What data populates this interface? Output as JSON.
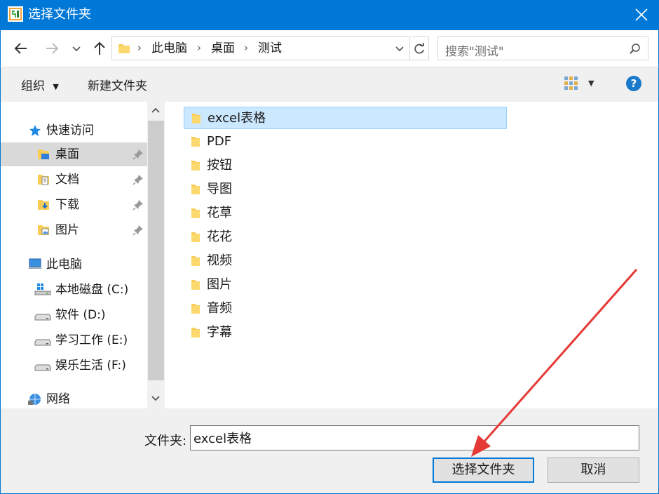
{
  "window": {
    "title": "选择文件夹",
    "accent": "#0078d7"
  },
  "address_bar": {
    "path": [
      "此电脑",
      "桌面",
      "测试"
    ]
  },
  "search": {
    "placeholder": "搜索\"测试\""
  },
  "toolbar": {
    "organize_label": "组织",
    "new_folder_label": "新建文件夹"
  },
  "nav_pane": {
    "quick_access": "快速访问",
    "quick_items": [
      {
        "label": "桌面",
        "icon": "desktop-folder-icon"
      },
      {
        "label": "文档",
        "icon": "documents-folder-icon"
      },
      {
        "label": "下载",
        "icon": "downloads-folder-icon"
      },
      {
        "label": "图片",
        "icon": "pictures-folder-icon"
      }
    ],
    "this_pc": "此电脑",
    "drives": [
      {
        "label": "本地磁盘 (C:)",
        "icon": "windows-drive-icon"
      },
      {
        "label": "软件 (D:)",
        "icon": "drive-icon"
      },
      {
        "label": "学习工作 (E:)",
        "icon": "drive-icon"
      },
      {
        "label": "娱乐生活 (F:)",
        "icon": "drive-icon"
      }
    ],
    "network": "网络"
  },
  "files": [
    {
      "name": "excel表格",
      "selected": true
    },
    {
      "name": "PDF"
    },
    {
      "name": "按钮"
    },
    {
      "name": "导图"
    },
    {
      "name": "花草"
    },
    {
      "name": "花花"
    },
    {
      "name": "视频"
    },
    {
      "name": "图片"
    },
    {
      "name": "音频"
    },
    {
      "name": "字幕"
    }
  ],
  "footer": {
    "folder_label": "文件夹:",
    "folder_value": "excel表格",
    "select_button": "选择文件夹",
    "cancel_button": "取消"
  },
  "annotation": {
    "arrow_color": "#e53935"
  }
}
